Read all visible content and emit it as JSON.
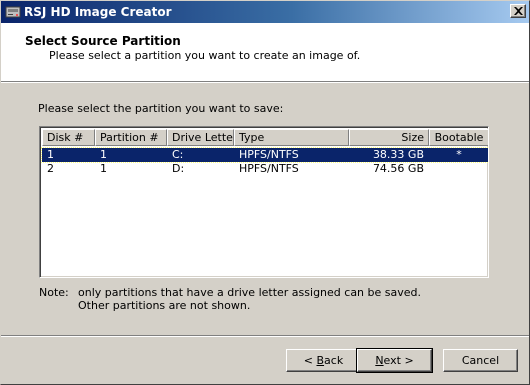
{
  "window": {
    "title": "RSJ HD Image Creator"
  },
  "header": {
    "title": "Select Source Partition",
    "subtitle": "Please select a partition you want to create an image of."
  },
  "prompt": "Please select the partition you want to save:",
  "table": {
    "columns": [
      "Disk #",
      "Partition #",
      "Drive Letter",
      "Type",
      "Size",
      "Bootable"
    ],
    "rows": [
      {
        "disk": "1",
        "partition": "1",
        "letter": "C:",
        "type": "HPFS/NTFS",
        "size": "38.33 GB",
        "bootable": "*",
        "selected": true
      },
      {
        "disk": "2",
        "partition": "1",
        "letter": "D:",
        "type": "HPFS/NTFS",
        "size": "74.56 GB",
        "bootable": "",
        "selected": false
      }
    ]
  },
  "note": {
    "label": "Note:",
    "line1": "only partitions that have a drive letter assigned can be saved.",
    "line2": "Other partitions are not shown."
  },
  "buttons": {
    "back": {
      "pre": "< ",
      "mnemonic": "B",
      "post": "ack"
    },
    "next": {
      "pre": "",
      "mnemonic": "N",
      "post": "ext >"
    },
    "cancel": "Cancel"
  },
  "colors": {
    "titlebar_start": "#0a246a",
    "titlebar_end": "#a6caf0",
    "selection": "#0a246a",
    "face": "#d4d0c8"
  },
  "icons": {
    "app": "disk-image-icon",
    "close": "close-icon"
  }
}
